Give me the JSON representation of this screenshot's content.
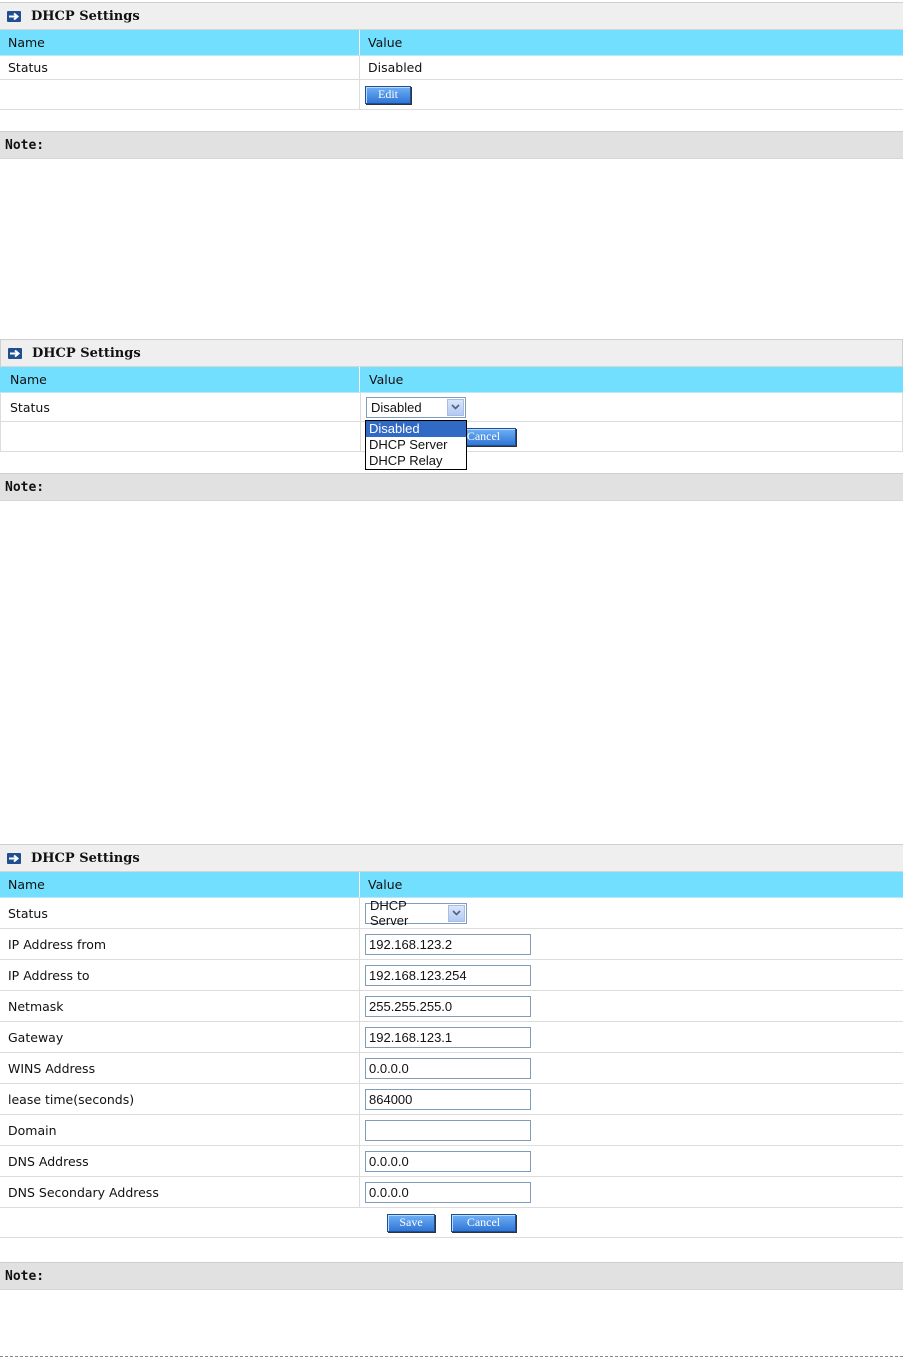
{
  "panel1": {
    "title": "DHCP Settings",
    "col_name": "Name",
    "col_value": "Value",
    "status_label": "Status",
    "status_value": "Disabled",
    "edit_label": "Edit",
    "note_label": "Note:"
  },
  "panel2": {
    "title": "DHCP Settings",
    "col_name": "Name",
    "col_value": "Value",
    "status_label": "Status",
    "status_selected": "Disabled",
    "options": [
      "Disabled",
      "DHCP Server",
      "DHCP Relay"
    ],
    "cancel_label": "Cancel",
    "note_label": "Note:"
  },
  "panel3": {
    "title": "DHCP Settings",
    "col_name": "Name",
    "col_value": "Value",
    "status_label": "Status",
    "status_selected": "DHCP Server",
    "rows": [
      {
        "label": "IP Address from",
        "value": "192.168.123.2"
      },
      {
        "label": "IP Address to",
        "value": "192.168.123.254"
      },
      {
        "label": "Netmask",
        "value": "255.255.255.0"
      },
      {
        "label": "Gateway",
        "value": "192.168.123.1"
      },
      {
        "label": "WINS Address",
        "value": "0.0.0.0"
      },
      {
        "label": "lease time(seconds)",
        "value": "864000"
      },
      {
        "label": "Domain",
        "value": ""
      },
      {
        "label": "DNS Address",
        "value": "0.0.0.0"
      },
      {
        "label": "DNS Secondary Address",
        "value": "0.0.0.0"
      }
    ],
    "save_label": "Save",
    "cancel_label": "Cancel",
    "note_label": "Note:"
  },
  "colors": {
    "header_blue": "#72dfff",
    "button_blue": "#2f76d6",
    "note_bg": "#e1e1e1"
  }
}
